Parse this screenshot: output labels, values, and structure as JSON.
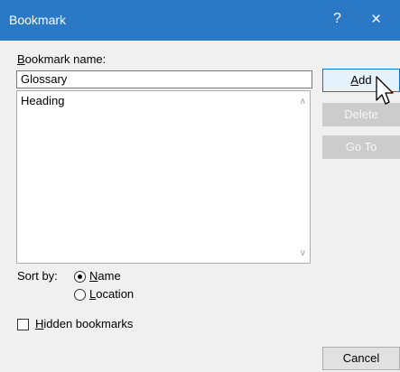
{
  "window": {
    "title": "Bookmark",
    "help": "?",
    "close": "×"
  },
  "form": {
    "name_label_key": "B",
    "name_label_rest": "ookmark name:",
    "name_value": "Glossary",
    "list_items": [
      "Heading"
    ]
  },
  "buttons": {
    "add_key": "A",
    "add_rest": "dd",
    "delete": "Delete",
    "goto": "Go To",
    "cancel": "Cancel"
  },
  "sort": {
    "label": "Sort by:",
    "name_key": "N",
    "name_rest": "ame",
    "location_key": "L",
    "location_rest": "ocation",
    "selected": "name"
  },
  "hidden": {
    "key": "H",
    "rest": "idden bookmarks",
    "checked": false
  },
  "icons": {
    "scroll_up": "chevron-up-icon",
    "scroll_down": "chevron-down-icon",
    "cursor": "mouse-pointer-icon"
  }
}
